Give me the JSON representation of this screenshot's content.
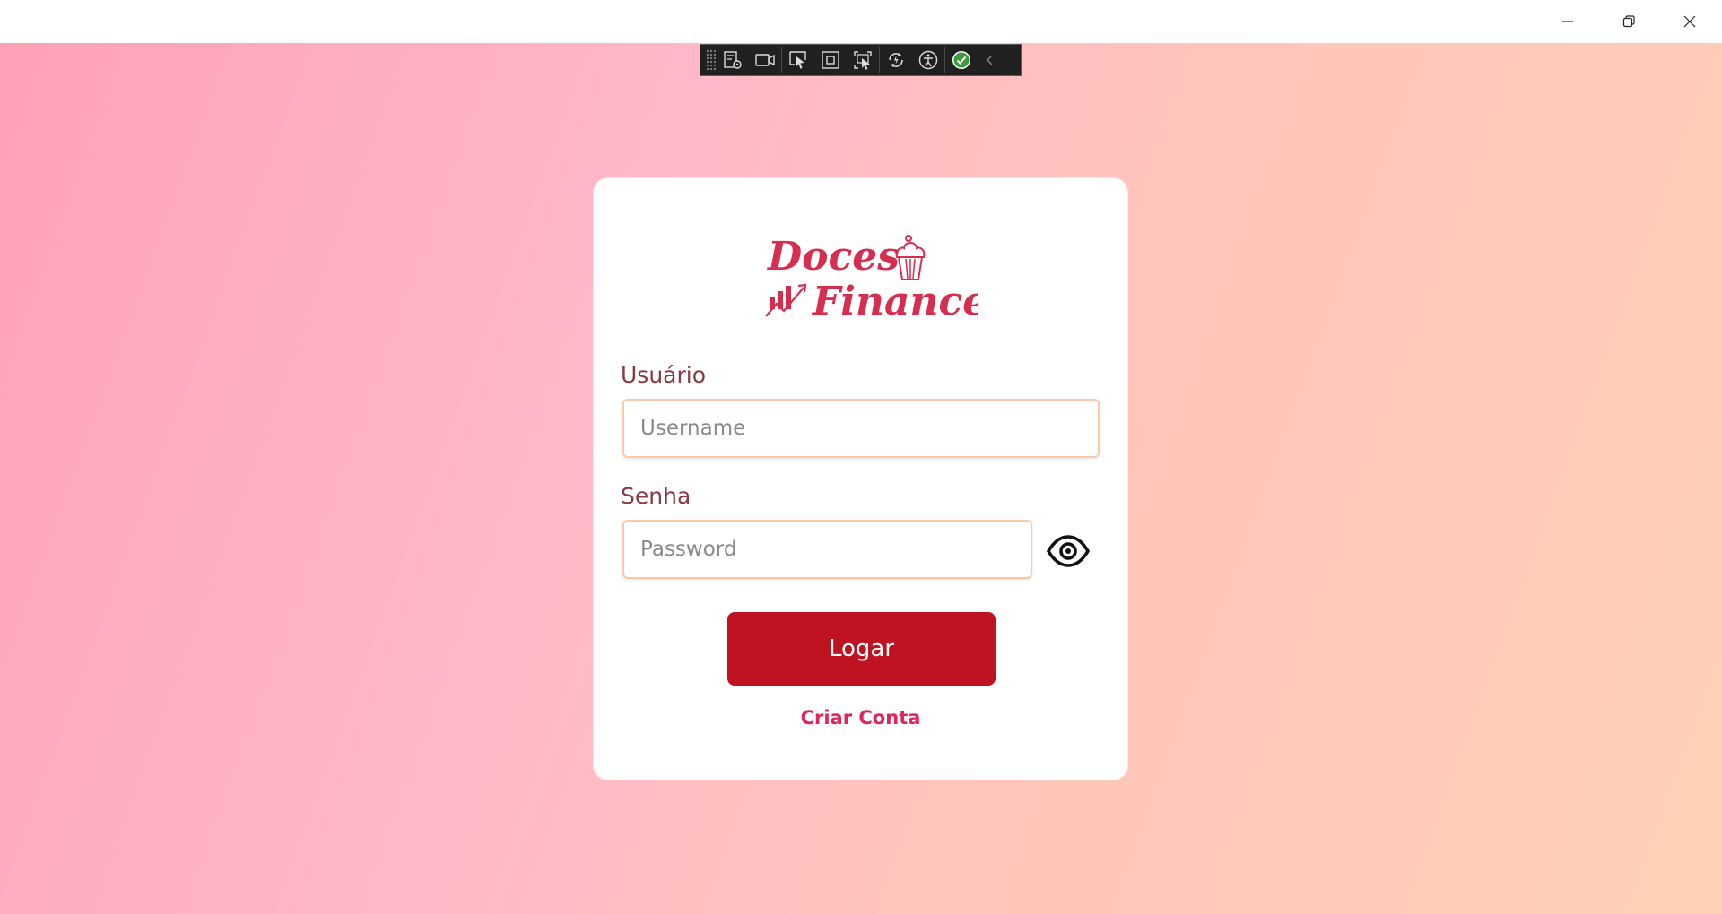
{
  "brand": {
    "logo_line1": "Doces",
    "logo_line2": "Finance",
    "logo_color": "#d62e4f"
  },
  "form": {
    "username_label": "Usuário",
    "username_placeholder": "Username",
    "username_value": "",
    "password_label": "Senha",
    "password_placeholder": "Password",
    "password_value": "",
    "show_password_icon": "eye-icon",
    "login_button": "Logar",
    "create_account_link": "Criar Conta"
  },
  "colors": {
    "accent": "#bf1322",
    "link": "#e0245e",
    "label": "#8b3a45",
    "input_border": "#fcc9a8"
  },
  "dev_toolbar": {
    "tools": [
      "live-visual-tree-icon",
      "record-icon",
      "select-element-icon",
      "display-layout-adorners-icon",
      "track-focus-icon",
      "hot-reload-icon",
      "accessibility-icon",
      "binding-status-icon",
      "collapse-icon"
    ]
  },
  "window_controls": {
    "icons": [
      "minimize-icon",
      "restore-icon",
      "close-icon"
    ]
  }
}
